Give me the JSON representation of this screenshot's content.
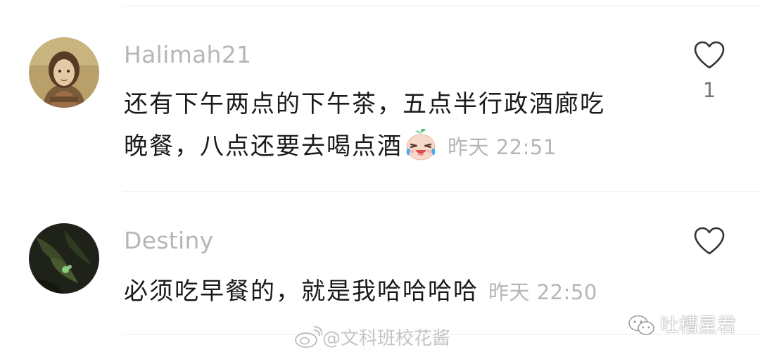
{
  "comments": [
    {
      "username": "Halimah21",
      "line1": "还有下午两点的下午茶，五点半行政酒廊吃",
      "line2": "晚餐，八点还要去喝点酒",
      "emoji": "crying-laughing-emoji",
      "time": "昨天 22:51",
      "like_count": "1",
      "avatar": "painting-portrait-avatar"
    },
    {
      "username": "Destiny",
      "line1": "必须吃早餐的，就是我哈哈哈哈",
      "time": "昨天 22:50",
      "like_count": "",
      "avatar": "dark-plant-avatar"
    }
  ],
  "watermarks": {
    "weibo": "@文科班校花酱",
    "wechat": "吐槽星君"
  },
  "colors": {
    "username": "#b6b6b6",
    "text": "#1a1a1a",
    "meta": "#b6b6b6",
    "divider": "#ececec"
  },
  "icons": {
    "like": "heart-outline-icon",
    "weibo": "weibo-logo-icon",
    "wechat": "wechat-logo-icon"
  }
}
